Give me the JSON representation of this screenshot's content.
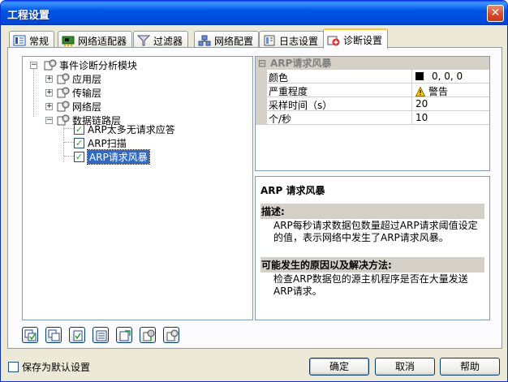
{
  "window": {
    "title": "工程设置",
    "close_glyph": "✕"
  },
  "tabs": [
    {
      "label": "常规",
      "icon": "general-icon"
    },
    {
      "label": "网络适配器",
      "icon": "adapter-icon"
    },
    {
      "label": "过滤器",
      "icon": "filter-icon"
    },
    {
      "label": "网络配置",
      "icon": "network-config-icon"
    },
    {
      "label": "日志设置",
      "icon": "log-icon"
    },
    {
      "label": "诊断设置",
      "icon": "diagnosis-icon",
      "active": true
    }
  ],
  "tree": {
    "root": "事件诊断分析模块",
    "layers": [
      "应用层",
      "传输层",
      "网络层",
      "数据链路层"
    ],
    "leaves": [
      "ARP太多无请求应答",
      "ARP扫描",
      "ARP请求风暴"
    ],
    "selected": "ARP请求风暴"
  },
  "toolbar_buttons": [
    "check-all-icon",
    "collapse-icon",
    "toggle-icon",
    "properties-icon",
    "import-icon",
    "export-icon",
    "reset-icon"
  ],
  "property_grid": {
    "header": "ARP请求风暴",
    "rows": [
      {
        "name": "颜色",
        "value": "0, 0, 0",
        "swatch": "#000000"
      },
      {
        "name": "严重程度",
        "value": "警告",
        "icon": "warning-icon"
      },
      {
        "name": "采样时间（s）",
        "value": "20"
      },
      {
        "name": "个/秒",
        "value": "10"
      }
    ]
  },
  "description": {
    "title": "ARP 请求风暴",
    "desc_heading": "描述:",
    "desc_text": "ARP每秒请求数据包数量超过ARP请求阈值设定的值，表示网络中发生了ARP请求风暴。",
    "cause_heading": "可能发生的原因以及解决方法:",
    "cause_text": "检查ARP数据包的源主机程序是否在大量发送ARP请求。"
  },
  "footer": {
    "save_default": "保存为默认设置",
    "ok": "确定",
    "cancel": "取消",
    "help": "帮助"
  }
}
